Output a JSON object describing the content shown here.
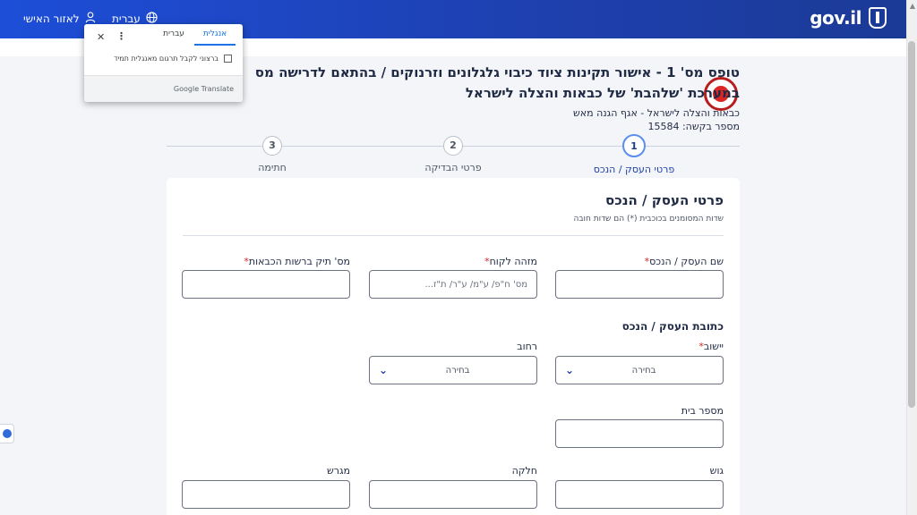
{
  "header": {
    "logo_text": "gov.il",
    "personal_area": "לאזור האישי",
    "language": "עברית",
    "brand_color": "#1e40af"
  },
  "translate_popup": {
    "tab_english": "אנגלית",
    "tab_hebrew": "עברית",
    "always_translate": "ברצוני לקבל תרגום מאנגלית תמיד",
    "brand": "Google Translate"
  },
  "form_header": {
    "title_line1": "טופס מס' 1 - אישור תקינות ציוד כיבוי גלגלונים וזרנוקים / בהתאם לדרישה מס' 09.",
    "title_line2": "במערכת 'שלהבת' של כבאות והצלה לישראל",
    "organization": "כבאות והצלה לישראל - אגף הגנה מאש",
    "request_number": "מספר בקשה: 15584"
  },
  "steps": [
    {
      "number": "1",
      "label": "פרטי העסק / הנכס",
      "active": true
    },
    {
      "number": "2",
      "label": "פרטי הבדיקה",
      "active": false
    },
    {
      "number": "3",
      "label": "חתימה",
      "active": false
    }
  ],
  "card": {
    "title": "פרטי העסק / הנכס",
    "required_note": "שדות המסומנים בכוכבית (*) הם שדות חובה",
    "fields": {
      "business_name": {
        "label": "שם העסק / הנכס",
        "required": "*",
        "value": ""
      },
      "client_id": {
        "label": "מזהה לקוח",
        "required": "*",
        "placeholder": "מס' ח\"פ/ ע\"מ/ ע\"ר/ ת\"ז..."
      },
      "licence_file": {
        "label": "מס' תיק ברשות הכבאות",
        "required": "*",
        "value": ""
      }
    },
    "address_title": "כתובת העסק / הנכס",
    "address": {
      "settlement": {
        "label": "יישוב",
        "required": "*",
        "value": "בחירה"
      },
      "street": {
        "label": "רחוב",
        "value": "בחירה"
      },
      "house_number": {
        "label": "מספר בית",
        "value": ""
      },
      "block": {
        "label": "גוש",
        "value": ""
      },
      "parcel": {
        "label": "חלקה",
        "value": ""
      },
      "plot": {
        "label": "מגרש",
        "value": ""
      }
    }
  }
}
